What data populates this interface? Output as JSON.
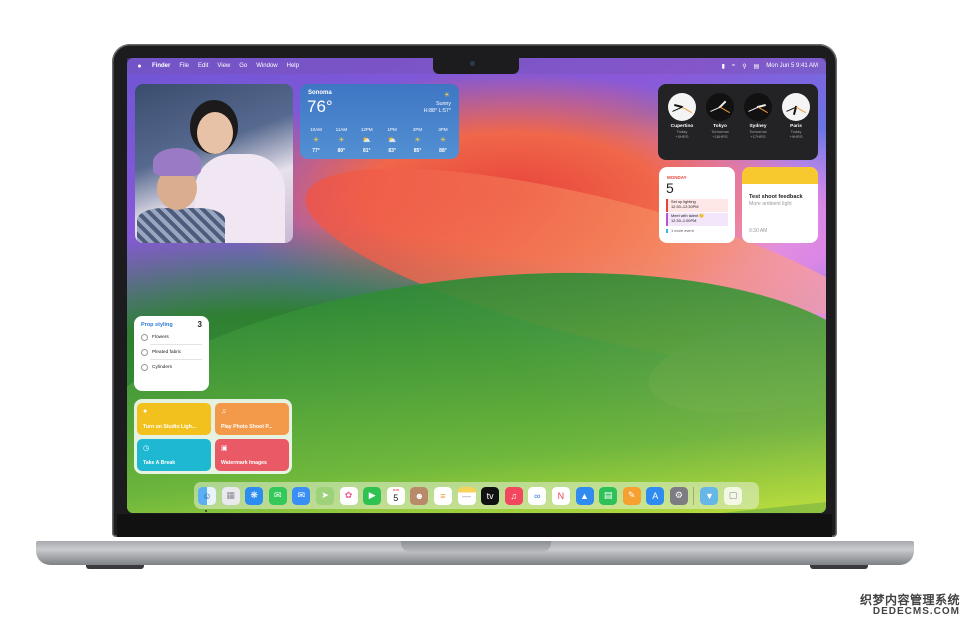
{
  "menubar": {
    "items": [
      "Finder",
      "File",
      "Edit",
      "View",
      "Go",
      "Window",
      "Help"
    ],
    "datetime": "Mon Jun 5  9:41 AM"
  },
  "weather": {
    "city": "Sonoma",
    "temp": "76°",
    "condition": "Sunny",
    "hilo": "H:88° L:57°",
    "hours": [
      {
        "time": "10AM",
        "icon": "sun-icon",
        "temp": "77°"
      },
      {
        "time": "11AM",
        "icon": "sun-icon",
        "temp": "80°"
      },
      {
        "time": "12PM",
        "icon": "partly-cloudy-icon",
        "temp": "81°"
      },
      {
        "time": "1PM",
        "icon": "partly-cloudy-icon",
        "temp": "83°"
      },
      {
        "time": "2PM",
        "icon": "sun-icon",
        "temp": "85°"
      },
      {
        "time": "3PM",
        "icon": "sun-icon",
        "temp": "88°"
      }
    ]
  },
  "world_clock": [
    {
      "city": "Cupertino",
      "day": "Today",
      "offset": "+0HRS"
    },
    {
      "city": "Tokyo",
      "day": "Tomorrow",
      "offset": "+16HRS"
    },
    {
      "city": "Sydney",
      "day": "Tomorrow",
      "offset": "+17HRS"
    },
    {
      "city": "Paris",
      "day": "Today",
      "offset": "+9HRS"
    }
  ],
  "calendar": {
    "weekday": "MONDAY",
    "date": "5",
    "events": [
      {
        "title": "Set up lighting",
        "time": "12:30–12:30PM"
      },
      {
        "title": "Meet with talent 🙂",
        "time": "12:30–1:00PM"
      }
    ],
    "more": "1 more event"
  },
  "note": {
    "title": "Test shoot feedback",
    "body": "More ambient light",
    "time": "9:30 AM"
  },
  "reminders": {
    "list": "Prop styling",
    "count": "3",
    "items": [
      "Flowers",
      "Pleated fabric",
      "Cylinders"
    ]
  },
  "shortcuts": [
    {
      "label": "Turn on Studio Ligh...",
      "icon": "lightbulb-icon",
      "color": "#f2c11d"
    },
    {
      "label": "Play Photo Shoot P...",
      "icon": "music-note-icon",
      "color": "#f39a4a"
    },
    {
      "label": "Take A Break",
      "icon": "timer-icon",
      "color": "#1fb8d3"
    },
    {
      "label": "Watermark Images",
      "icon": "image-icon",
      "color": "#ea5a66"
    }
  ],
  "dock": {
    "calendar_month": "JUN",
    "calendar_day": "5",
    "apps": [
      "Finder",
      "Launchpad",
      "Safari",
      "Messages",
      "Mail",
      "Maps",
      "Photos",
      "FaceTime",
      "Calendar",
      "Contacts",
      "Reminders",
      "Notes",
      "TV",
      "Music",
      "Freeform",
      "News",
      "Keynote",
      "Numbers",
      "Pages",
      "App Store",
      "System Settings",
      "Downloads",
      "Trash"
    ]
  },
  "watermark": {
    "line1": "织梦内容管理系统",
    "line2": "DEDECMS.COM"
  }
}
